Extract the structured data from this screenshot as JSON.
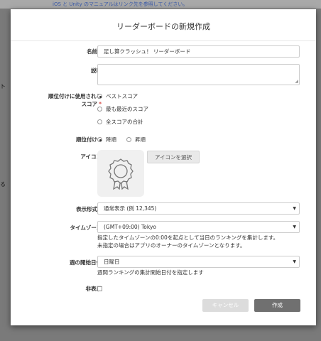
{
  "background": {
    "top_note": "iOS と Unity のマニュアルはリンク先を参照してください。",
    "left_fragment_1": "ト",
    "left_fragment_2": "る"
  },
  "modal": {
    "title": "リーダーボードの新規作成",
    "name": {
      "label": "名前",
      "required_mark": "*",
      "value": "足し算クラッシュ！ リーダーボード"
    },
    "description": {
      "label": "説明",
      "value": ""
    },
    "ranking_score": {
      "label_line1": "順位付けに使用される",
      "label_line2": "スコア",
      "required_mark": "*",
      "options": [
        "ベストスコア",
        "最も最近のスコア",
        "全スコアの合計"
      ],
      "selected": "ベストスコア"
    },
    "ranking_order": {
      "label": "順位付け",
      "required_mark": "*",
      "options": [
        "降順",
        "昇順"
      ],
      "selected": "降順"
    },
    "icon": {
      "label": "アイコン",
      "select_button": "アイコンを選択",
      "placeholder_icon": "badge-icon"
    },
    "display_format": {
      "label": "表示形式",
      "required_mark": "*",
      "value": "通常表示 (例 12,345)"
    },
    "timezone": {
      "label": "タイムゾーン",
      "value": "(GMT+09:00) Tokyo",
      "hint_line1": "指定したタイムゾーンの0:00を起点として当日のランキングを集計します。",
      "hint_line2": "未指定の場合はアプリのオーナーのタイムゾーンとなります。"
    },
    "week_start": {
      "label": "週の開始日付",
      "value": "日曜日",
      "hint": "週間ランキングの集計開始日付を指定します"
    },
    "hidden": {
      "label": "非表示",
      "checked": false
    },
    "buttons": {
      "cancel": "キャンセル",
      "create": "作成"
    }
  }
}
